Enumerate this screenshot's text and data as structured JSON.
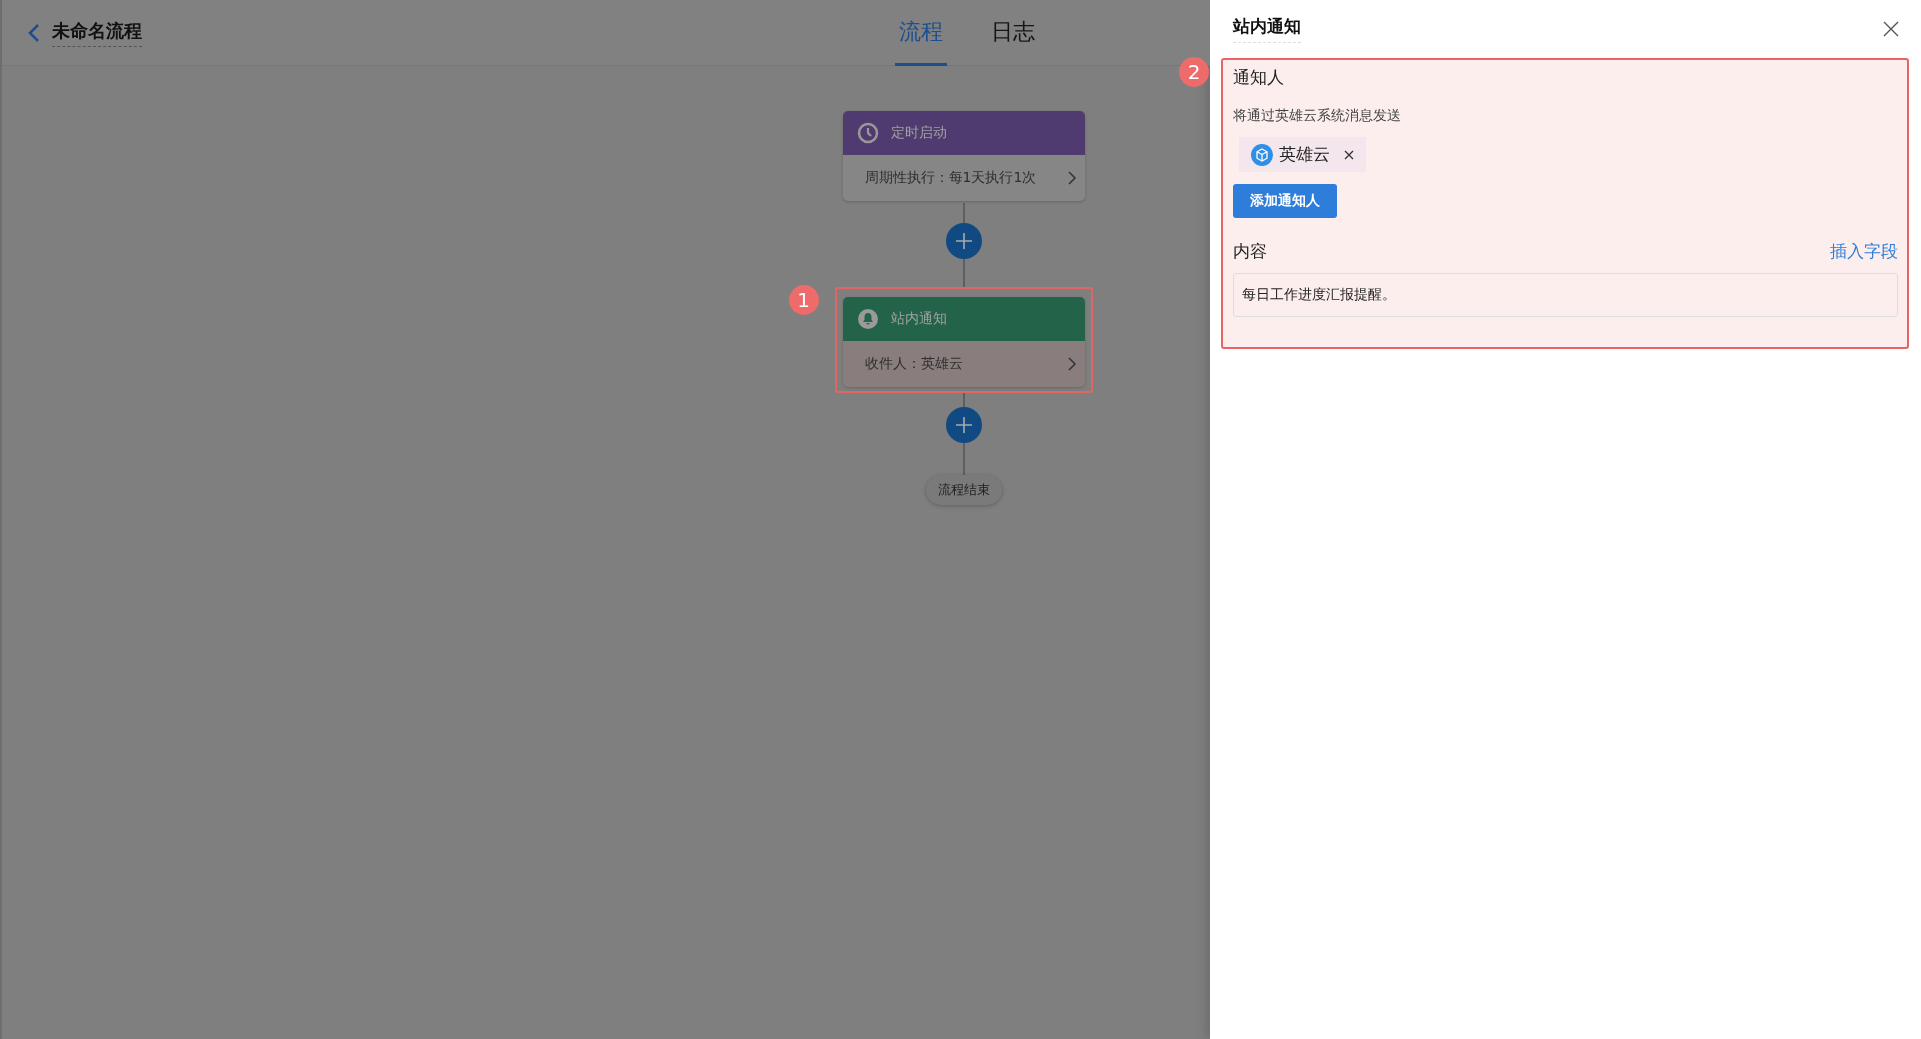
{
  "header": {
    "back_label": "未命名流程",
    "tabs": [
      {
        "label": "流程",
        "selected": true
      },
      {
        "label": "日志",
        "selected": false
      }
    ]
  },
  "flow": {
    "nodes": [
      {
        "kind": "timer",
        "title": "定时启动",
        "detail": "周期性执行：每1天执行1次",
        "color": "#4f3b6f",
        "highlighted": false
      },
      {
        "kind": "notify",
        "title": "站内通知",
        "detail": "收件人：英雄云",
        "color": "#22634a",
        "highlighted": true,
        "marker": "1"
      }
    ],
    "end_label": "流程结束"
  },
  "drawer": {
    "title": "站内通知",
    "marker": "2",
    "recipients_label": "通知人",
    "hint": "将通过英雄云系统消息发送",
    "recipients": [
      {
        "name": "英雄云"
      }
    ],
    "add_button": "添加通知人",
    "content_label": "内容",
    "insert_link": "插入字段",
    "content": "每日工作进度汇报提醒。"
  }
}
